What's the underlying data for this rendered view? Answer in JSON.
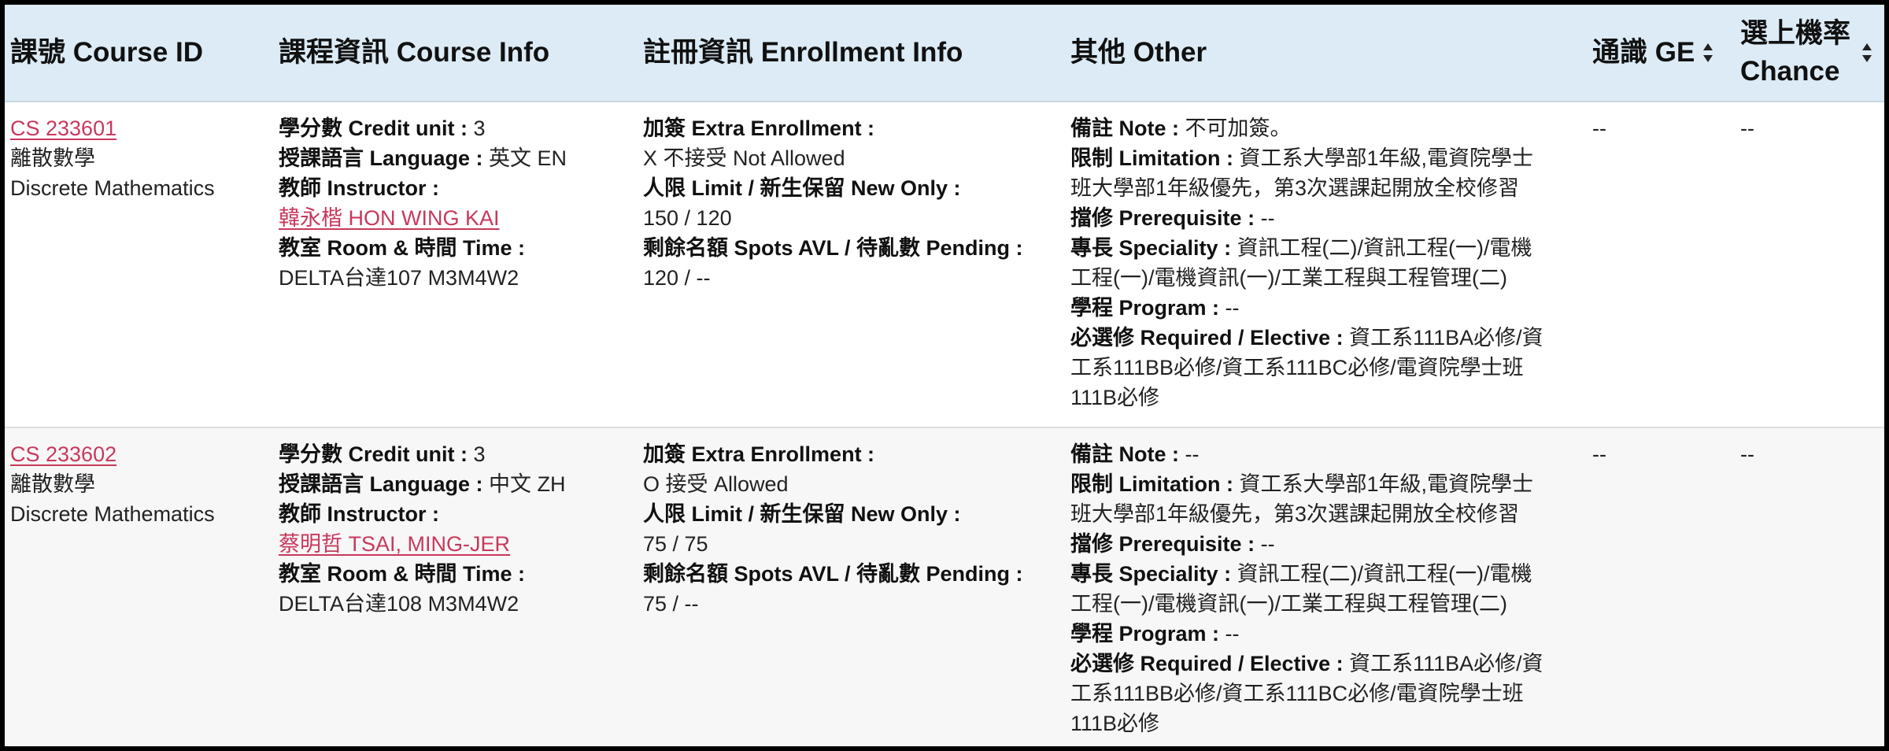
{
  "headers": {
    "course_id": "課號 Course ID",
    "course_info": "課程資訊 Course Info",
    "enrollment_info": "註冊資訊 Enrollment Info",
    "other": "其他 Other",
    "ge": "通識 GE",
    "chance": "選上機率 Chance"
  },
  "labels": {
    "credit": "學分數 Credit unit : ",
    "language": "授課語言 Language : ",
    "instructor": "教師 Instructor :",
    "room_time": "教室 Room & 時間 Time :",
    "extra_enrollment": "加簽 Extra Enrollment :",
    "limit": "人限 Limit / 新生保留 New Only :",
    "spots": "剩餘名額 Spots AVL / 待亂數 Pending :",
    "note": "備註 Note : ",
    "limitation": "限制 Limitation : ",
    "prerequisite": "擋修 Prerequisite : ",
    "speciality": "專長 Speciality : ",
    "program": "學程 Program : ",
    "required": "必選修 Required / Elective : "
  },
  "courses": [
    {
      "id": "CS 233601",
      "name_zh": "離散數學",
      "name_en": "Discrete Mathematics",
      "credit": "3",
      "language": "英文 EN",
      "instructor": "韓永楷 HON WING KAI",
      "room_time": "DELTA台達107 M3M4W2",
      "extra_enrollment": "X 不接受 Not Allowed",
      "limit": "150 / 120",
      "spots": "120 / --",
      "note": "不可加簽。",
      "limitation_line1": "資工系大學部1年級,電資院學士",
      "limitation_line2": "班大學部1年級優先，第3次選課起開放全校修習",
      "prerequisite": "--",
      "speciality_line1": "資訊工程(二)/資訊工程(一)/電機",
      "speciality_line2": "工程(一)/電機資訊(一)/工業工程與工程管理(二)",
      "program": "--",
      "required_line1": "資工系111BA必修/資",
      "required_line2": "工系111BB必修/資工系111BC必修/電資院學士班",
      "required_line3": "111B必修",
      "ge": "--",
      "chance": "--"
    },
    {
      "id": "CS 233602",
      "name_zh": "離散數學",
      "name_en": "Discrete Mathematics",
      "credit": "3",
      "language": "中文 ZH",
      "instructor": "蔡明哲 TSAI, MING-JER",
      "room_time": "DELTA台達108 M3M4W2",
      "extra_enrollment": "O 接受 Allowed",
      "limit": "75 / 75",
      "spots": "75 / --",
      "note": "--",
      "limitation_line1": "資工系大學部1年級,電資院學士",
      "limitation_line2": "班大學部1年級優先，第3次選課起開放全校修習",
      "prerequisite": "--",
      "speciality_line1": "資訊工程(二)/資訊工程(一)/電機",
      "speciality_line2": "工程(一)/電機資訊(一)/工業工程與工程管理(二)",
      "program": "--",
      "required_line1": "資工系111BA必修/資",
      "required_line2": "工系111BB必修/資工系111BC必修/電資院學士班",
      "required_line3": "111B必修",
      "ge": "--",
      "chance": "--"
    }
  ]
}
